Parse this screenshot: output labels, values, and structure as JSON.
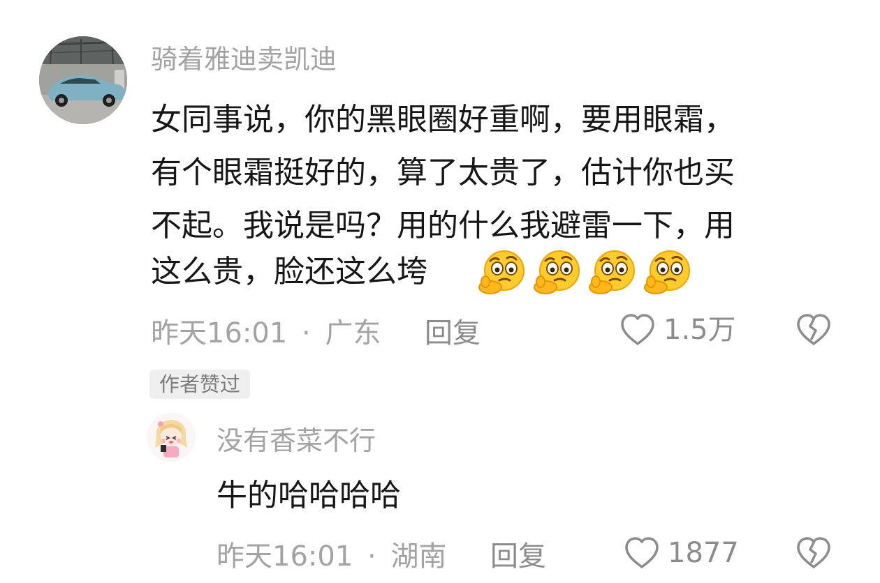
{
  "comment": {
    "username": "骑着雅迪卖凯迪",
    "lines": [
      "女同事说，你的黑眼圈好重啊，要用眼霜，",
      "有个眼霜挺好的，算了太贵了，估计你也买",
      "不起。我说是吗？用的什么我避雷一下，用",
      "这么贵，脸还这么垮"
    ],
    "emoji_name": "thinking-face-emoji",
    "time": "昨天16:01",
    "dot": "·",
    "location": "广东",
    "reply_label": "回复",
    "likes": "1.5万",
    "author_liked_badge": "作者赞过"
  },
  "reply": {
    "username": "没有香菜不行",
    "text": "牛的哈哈哈哈",
    "time": "昨天16:01",
    "dot": "·",
    "location": "湖南",
    "reply_label": "回复",
    "likes": "1877"
  },
  "colors": {
    "primary_text": "#161616",
    "secondary_text": "#a3a3a3",
    "action_text": "#8c8c8c",
    "badge_bg": "#efefef"
  }
}
